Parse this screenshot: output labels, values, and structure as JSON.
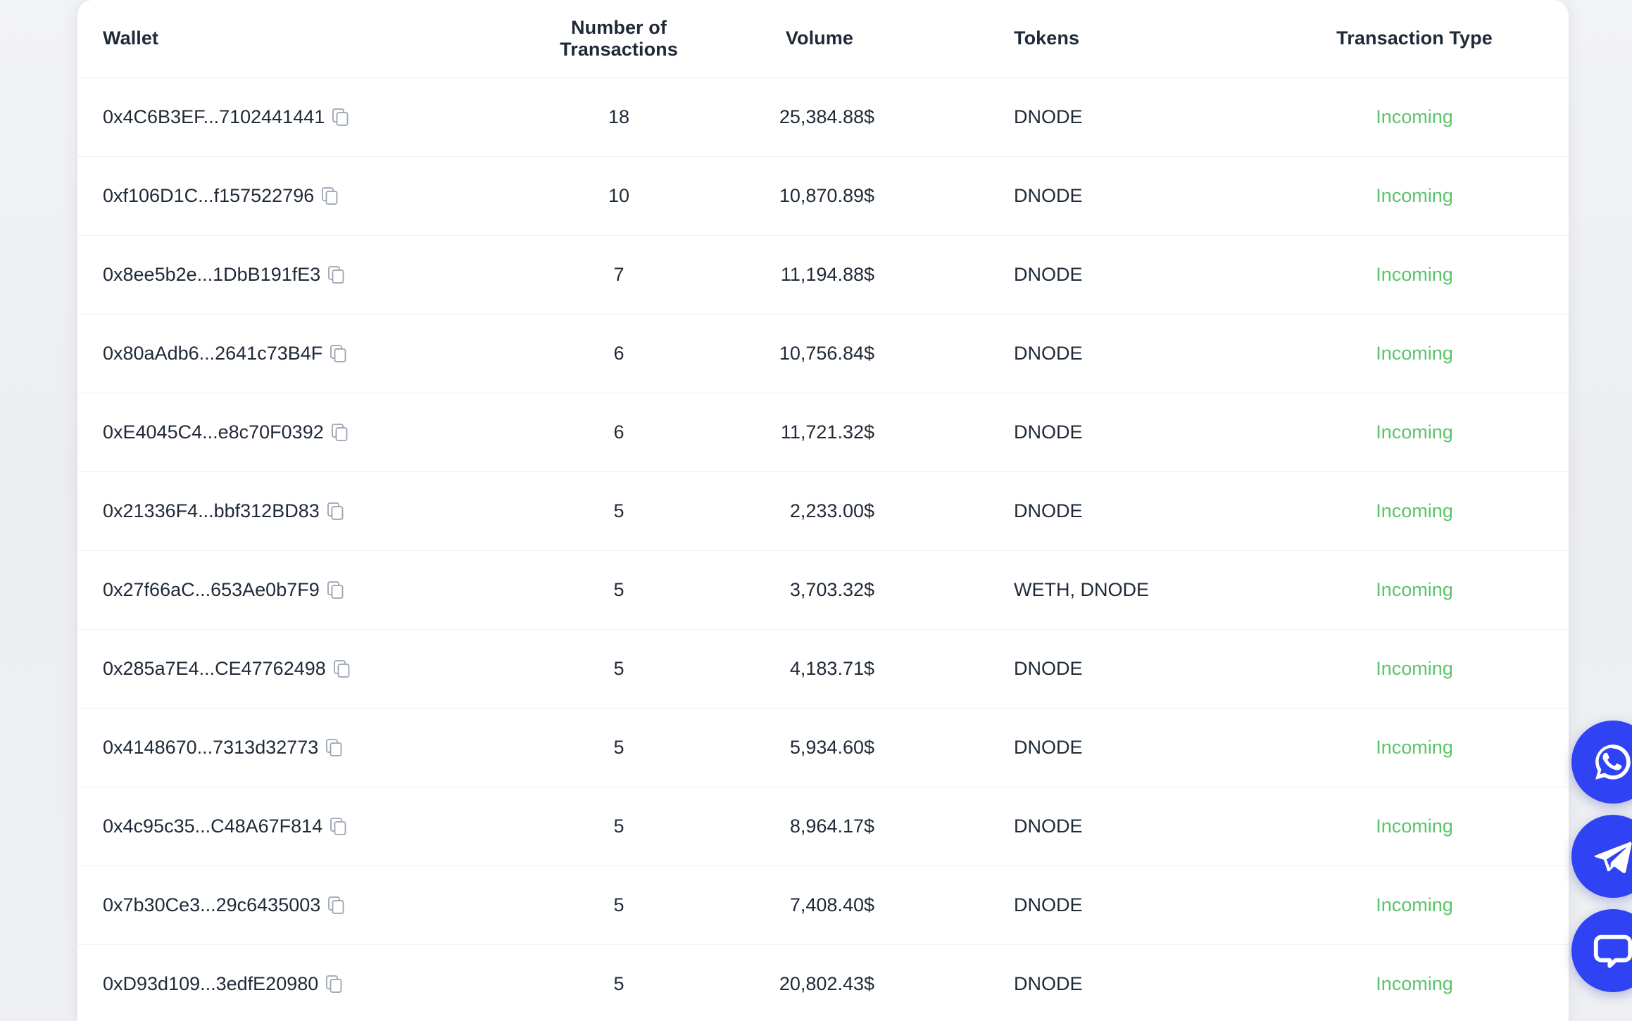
{
  "table": {
    "columns": [
      {
        "key": "wallet",
        "label": "Wallet"
      },
      {
        "key": "txcount",
        "label_line1": "Number of",
        "label_line2": "Transactions"
      },
      {
        "key": "volume",
        "label": "Volume"
      },
      {
        "key": "tokens",
        "label": "Tokens"
      },
      {
        "key": "type",
        "label": "Transaction Type"
      }
    ],
    "rows": [
      {
        "wallet": "0x4C6B3EF...7102441441",
        "txcount": "18",
        "volume": "25,384.88$",
        "tokens": "DNODE",
        "type": "Incoming"
      },
      {
        "wallet": "0xf106D1C...f157522796",
        "txcount": "10",
        "volume": "10,870.89$",
        "tokens": "DNODE",
        "type": "Incoming"
      },
      {
        "wallet": "0x8ee5b2e...1DbB191fE3",
        "txcount": "7",
        "volume": "11,194.88$",
        "tokens": "DNODE",
        "type": "Incoming"
      },
      {
        "wallet": "0x80aAdb6...2641c73B4F",
        "txcount": "6",
        "volume": "10,756.84$",
        "tokens": "DNODE",
        "type": "Incoming"
      },
      {
        "wallet": "0xE4045C4...e8c70F0392",
        "txcount": "6",
        "volume": "11,721.32$",
        "tokens": "DNODE",
        "type": "Incoming"
      },
      {
        "wallet": "0x21336F4...bbf312BD83",
        "txcount": "5",
        "volume": "2,233.00$",
        "tokens": "DNODE",
        "type": "Incoming"
      },
      {
        "wallet": "0x27f66aC...653Ae0b7F9",
        "txcount": "5",
        "volume": "3,703.32$",
        "tokens": "WETH, DNODE",
        "type": "Incoming"
      },
      {
        "wallet": "0x285a7E4...CE47762498",
        "txcount": "5",
        "volume": "4,183.71$",
        "tokens": "DNODE",
        "type": "Incoming"
      },
      {
        "wallet": "0x4148670...7313d32773",
        "txcount": "5",
        "volume": "5,934.60$",
        "tokens": "DNODE",
        "type": "Incoming"
      },
      {
        "wallet": "0x4c95c35...C48A67F814",
        "txcount": "5",
        "volume": "8,964.17$",
        "tokens": "DNODE",
        "type": "Incoming"
      },
      {
        "wallet": "0x7b30Ce3...29c6435003",
        "txcount": "5",
        "volume": "7,408.40$",
        "tokens": "DNODE",
        "type": "Incoming"
      },
      {
        "wallet": "0xD93d109...3edfE20980",
        "txcount": "5",
        "volume": "20,802.43$",
        "tokens": "DNODE",
        "type": "Incoming"
      }
    ],
    "row_icon": "copy-icon"
  },
  "floating_buttons": [
    {
      "icon": "whatsapp-icon",
      "name": "whatsapp"
    },
    {
      "icon": "telegram-icon",
      "name": "telegram"
    },
    {
      "icon": "chat-bubble-icon",
      "name": "live-chat"
    }
  ],
  "colors": {
    "accent_blue": "#2f43f5",
    "status_green": "#5cc46b",
    "text_primary": "#1f2937",
    "icon_gray": "#9aa3b0",
    "page_background": "#eef0f3",
    "card_background": "#ffffff",
    "row_divider": "#eff1f3"
  }
}
